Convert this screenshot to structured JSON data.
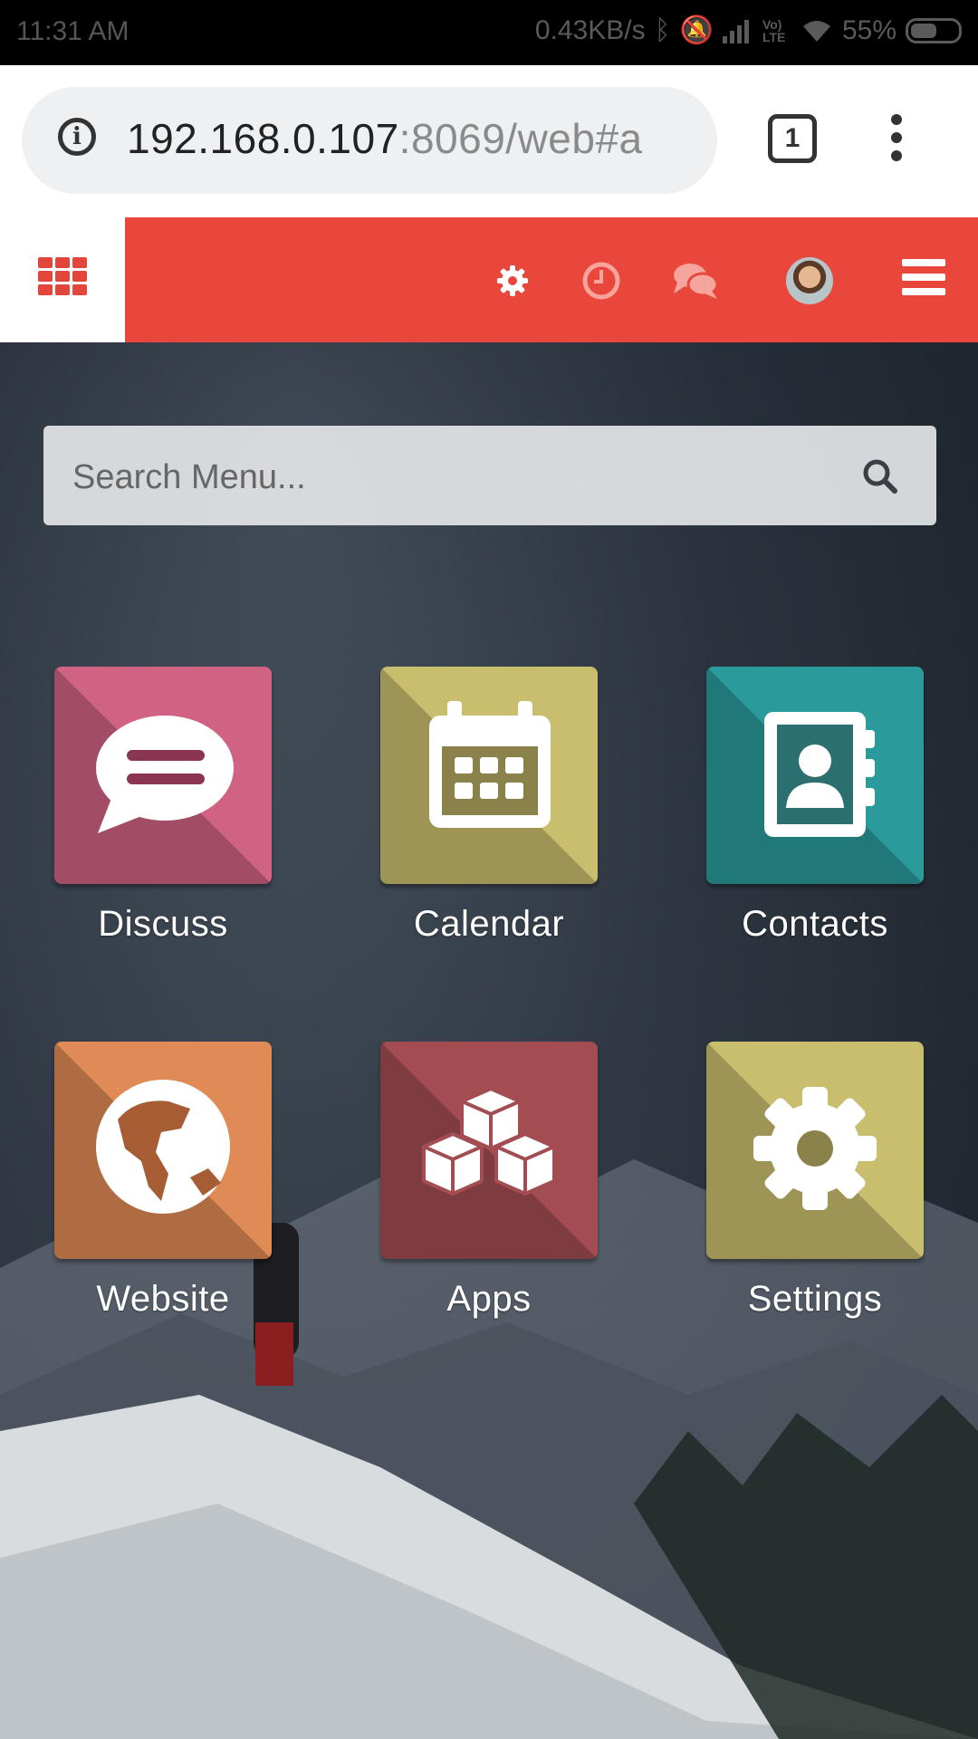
{
  "status_bar": {
    "time": "11:31 AM",
    "net_speed": "0.43KB/s",
    "network_label": "Vo) LTE",
    "battery": "55%"
  },
  "browser": {
    "url_host": "192.168.0.107",
    "url_rest": ":8069/web#a",
    "tab_count": "1"
  },
  "navbar": {
    "icons": [
      "apps-grid-icon",
      "settings-icon",
      "activity-clock-icon",
      "chat-icon",
      "avatar",
      "hamburger-icon"
    ],
    "color": "#e9473b"
  },
  "home": {
    "search_placeholder": "Search Menu...",
    "apps": [
      {
        "label": "Discuss",
        "color": "#d06283"
      },
      {
        "label": "Calendar",
        "color": "#c9bd6e"
      },
      {
        "label": "Contacts",
        "color": "#2a9a9b"
      },
      {
        "label": "Website",
        "color": "#e08a55"
      },
      {
        "label": "Apps",
        "color": "#a34d52"
      },
      {
        "label": "Settings",
        "color": "#c9bd6e"
      }
    ]
  }
}
